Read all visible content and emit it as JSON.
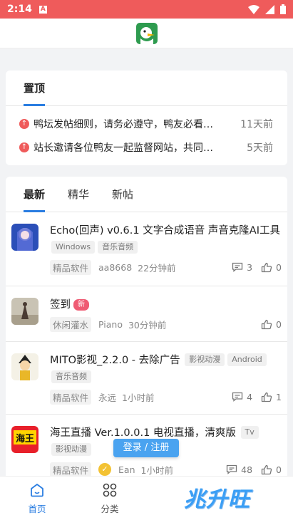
{
  "status": {
    "time": "2:14"
  },
  "pinned": {
    "tab": "置顶",
    "items": [
      {
        "title": "鸭坛发帖细则，请务必遵守，鸭友必看…",
        "date": "11天前"
      },
      {
        "title": "站长邀请各位鸭友一起监督网站，共同…",
        "date": "5天前"
      }
    ]
  },
  "feed": {
    "tabs": [
      "最新",
      "精华",
      "新帖"
    ],
    "posts": [
      {
        "title": "Echo(回声) v0.6.1 文字合成语音 声音克隆AI工具",
        "tags": [
          "Windows",
          "音乐音频"
        ],
        "category": "精品软件",
        "user": "aa8668",
        "time": "22分钟前",
        "comments": "3",
        "likes": "0"
      },
      {
        "title": "签到",
        "badge": "新",
        "category": "休闲灌水",
        "user": "Piano",
        "time": "30分钟前",
        "likes": "0"
      },
      {
        "title": "MITO影视_2.2.0 - 去除广告",
        "tags": [
          "影视动漫",
          "Android",
          "音乐音频"
        ],
        "category": "精品软件",
        "user": "永远",
        "time": "1小时前",
        "comments": "4",
        "likes": "1"
      },
      {
        "title": "海王直播 Ver.1.0.0.1 电视直播，清爽版",
        "tags": [
          "Tv",
          "影视动漫"
        ],
        "category": "精品软件",
        "user": "Ean",
        "time": "1小时前",
        "comments": "48",
        "likes": "0"
      }
    ]
  },
  "login_button": "登录 / 注册",
  "nav": {
    "home": "首页",
    "categories": "分类"
  },
  "watermark": "兆升旺",
  "colors": {
    "accent": "#2a7de1",
    "status_bar": "#ef5b5b",
    "badge": "#ef5b73"
  }
}
